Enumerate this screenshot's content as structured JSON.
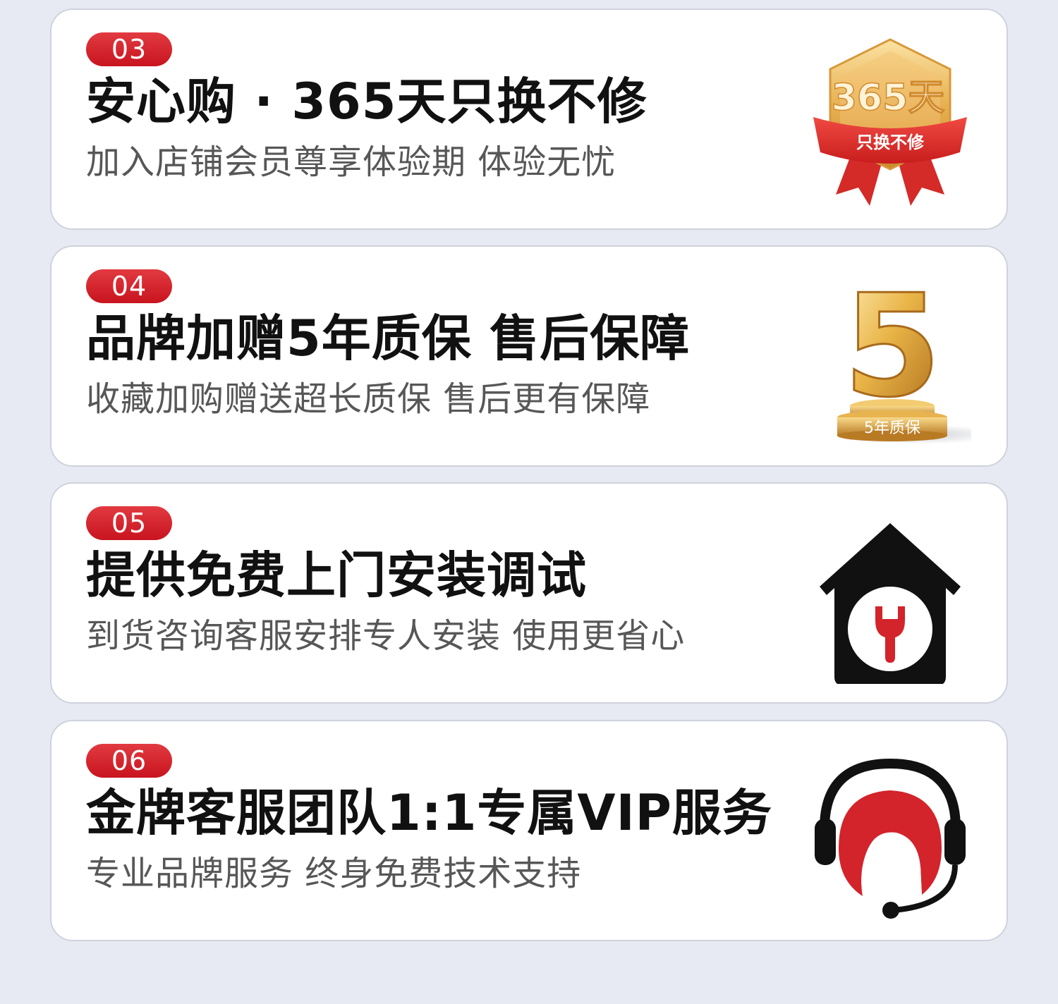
{
  "cards": [
    {
      "number": "03",
      "title": "安心购 · 365天只换不修",
      "subtitle": "加入店铺会员尊享体验期 体验无忧",
      "icon": "365-day-guarantee-medal-icon",
      "illus_main": "365天",
      "illus_ribbon": "只换不修"
    },
    {
      "number": "04",
      "title": "品牌加赠5年质保 售后保障",
      "subtitle": "收藏加购赠送超长质保 售后更有保障",
      "icon": "5-year-warranty-trophy-icon",
      "illus_digit": "5",
      "illus_plate": "5年质保"
    },
    {
      "number": "05",
      "title": "提供免费上门安装调试",
      "subtitle": "到货咨询客服安排专人安装 使用更省心",
      "icon": "home-repair-wrench-icon"
    },
    {
      "number": "06",
      "title": "金牌客服团队1:1专属VIP服务",
      "subtitle": "专业品牌服务 终身免费技术支持",
      "icon": "customer-service-headset-icon"
    }
  ],
  "colors": {
    "page_background": "#e8eaf3",
    "card_background": "#ffffff",
    "badge_red": "#d3232b",
    "title_text": "#111111",
    "subtitle_text": "#575757",
    "gold": "#e0a43a",
    "icon_black": "#111111"
  }
}
